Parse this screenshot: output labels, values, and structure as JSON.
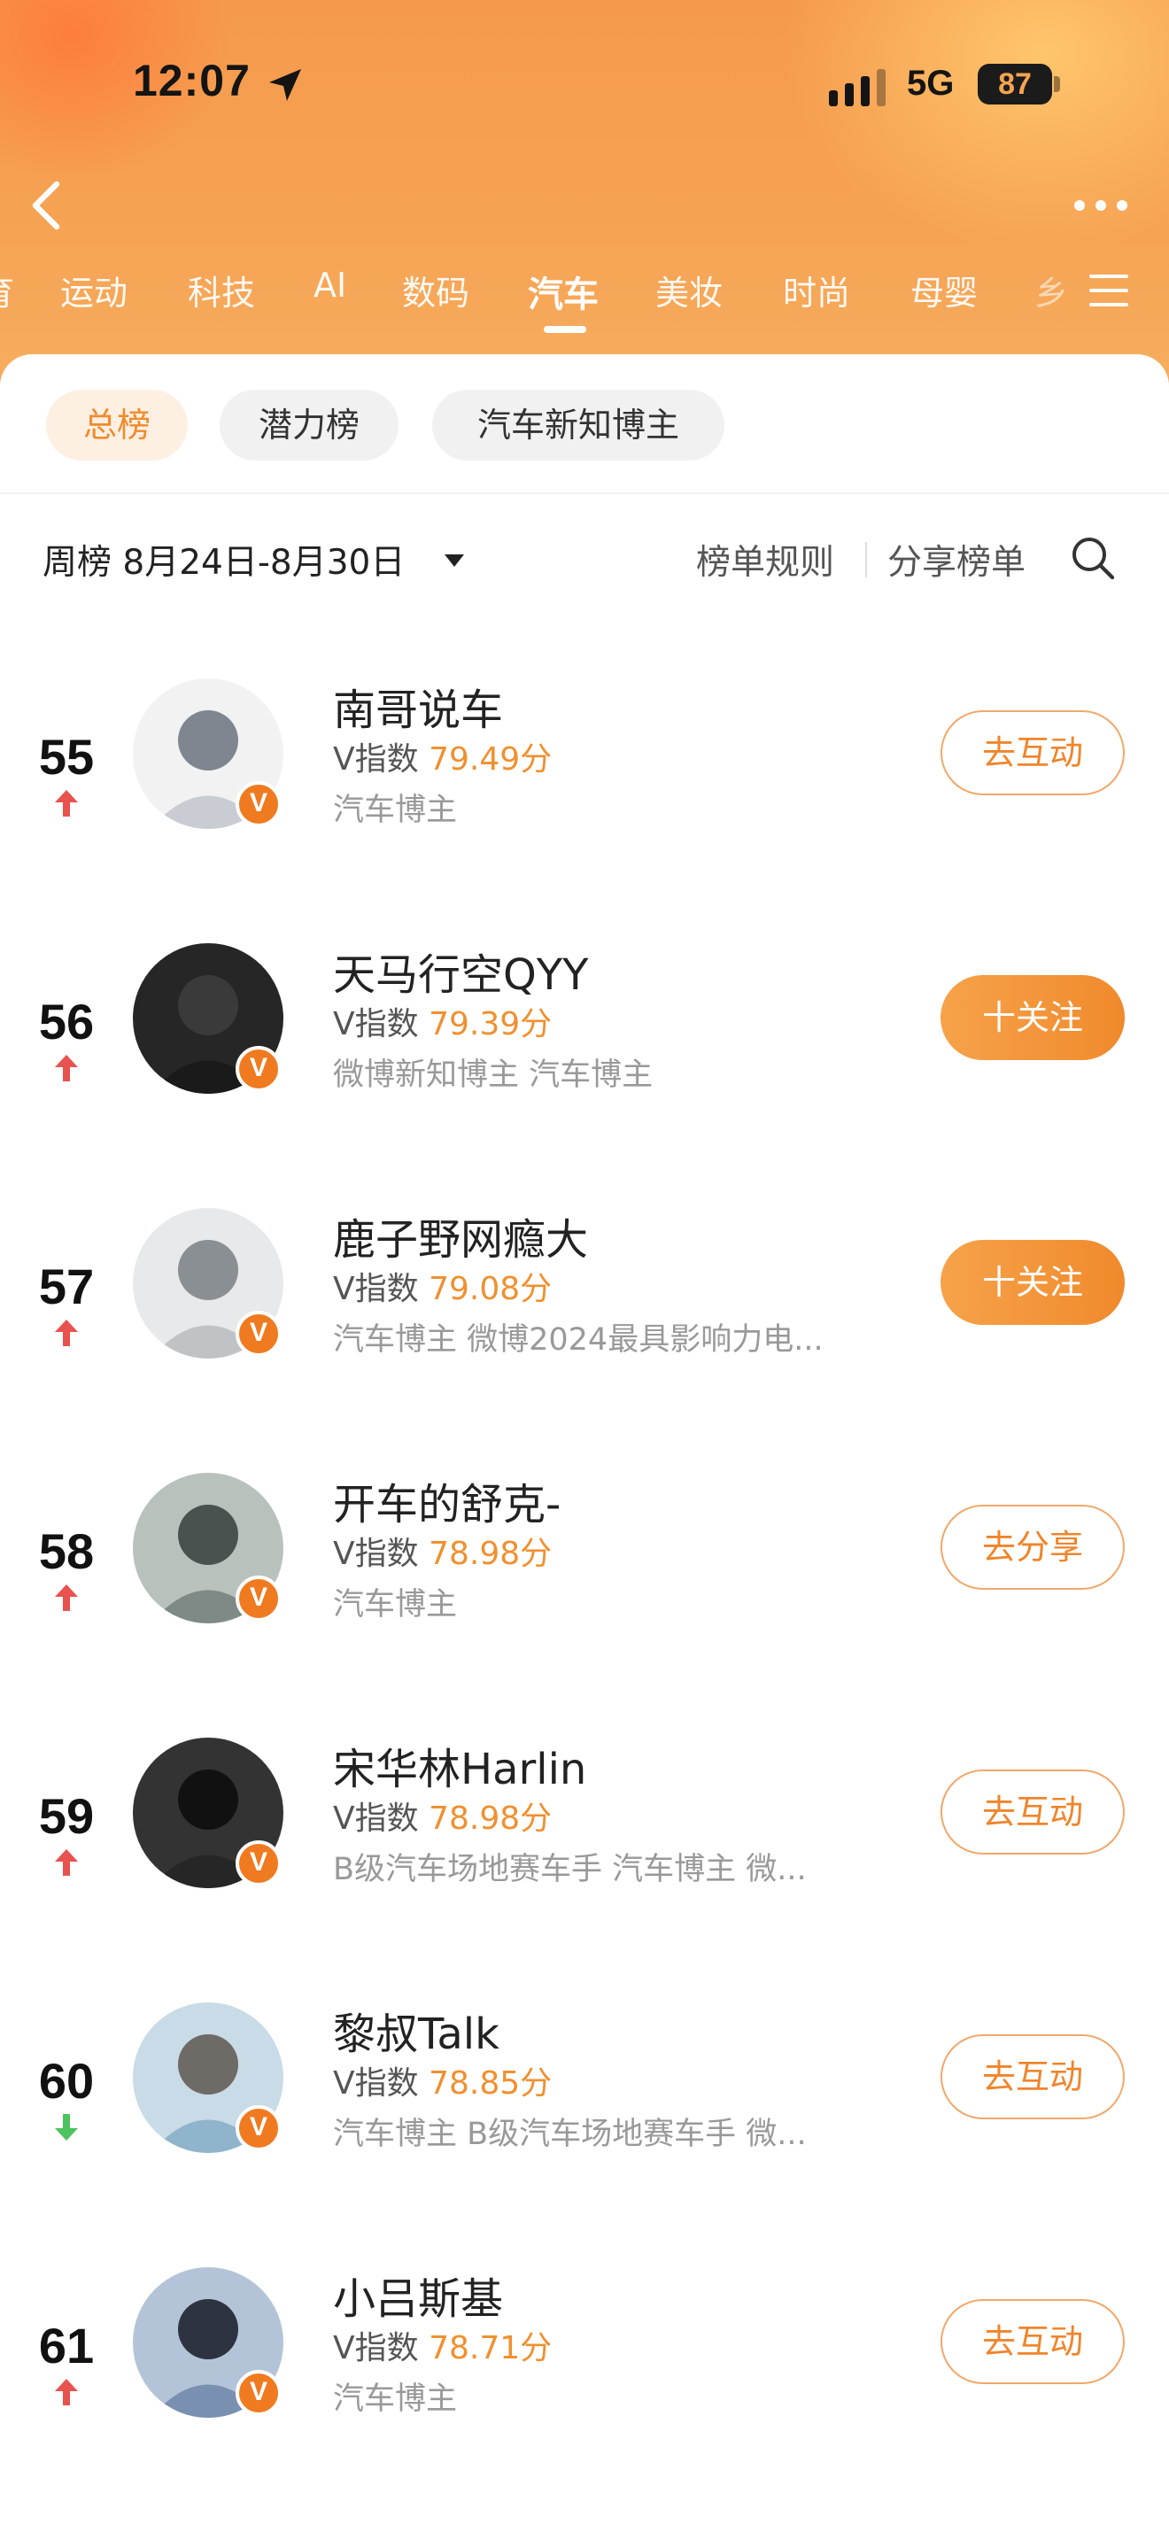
{
  "status_bar": {
    "time": "12:07",
    "network": "5G",
    "battery": "87",
    "icons": [
      "location-arrow-icon",
      "signal-icon"
    ]
  },
  "nav": {
    "back_icon": "chevron-left-icon",
    "more_icon": "more-dots-icon",
    "menu_icon": "hamburger-menu-icon"
  },
  "category_tabs": [
    {
      "label": "育",
      "active": false
    },
    {
      "label": "运动",
      "active": false
    },
    {
      "label": "科技",
      "active": false
    },
    {
      "label": "AI",
      "active": false
    },
    {
      "label": "数码",
      "active": false
    },
    {
      "label": "汽车",
      "active": true
    },
    {
      "label": "美妆",
      "active": false
    },
    {
      "label": "时尚",
      "active": false
    },
    {
      "label": "母婴",
      "active": false
    },
    {
      "label": "乡",
      "active": false
    }
  ],
  "sub_tabs": [
    {
      "label": "总榜",
      "active": true
    },
    {
      "label": "潜力榜",
      "active": false
    },
    {
      "label": "汽车新知博主",
      "active": false
    }
  ],
  "filter": {
    "period": "周榜 8月24日-8月30日",
    "rules": "榜单规则",
    "share": "分享榜单"
  },
  "colors": {
    "accent": "#f0842a",
    "score": "#f0902f",
    "trend_up": "#e8524f",
    "trend_down": "#4cc35f"
  },
  "rankings": [
    {
      "rank": "55",
      "trend": "up",
      "name": "南哥说车",
      "vindex_label": "V指数",
      "score": "79.49分",
      "tags": "汽车博主",
      "action": "去互动",
      "action_filled": false
    },
    {
      "rank": "56",
      "trend": "up",
      "name": "天马行空QYY",
      "vindex_label": "V指数",
      "score": "79.39分",
      "tags": "微博新知博主 汽车博主",
      "action": "十关注",
      "action_filled": true
    },
    {
      "rank": "57",
      "trend": "up",
      "name": "鹿子野网瘾大",
      "vindex_label": "V指数",
      "score": "79.08分",
      "tags": "汽车博主 微博2024最具影响力电...",
      "action": "十关注",
      "action_filled": true
    },
    {
      "rank": "58",
      "trend": "up",
      "name": "开车的舒克-",
      "vindex_label": "V指数",
      "score": "78.98分",
      "tags": "汽车博主",
      "action": "去分享",
      "action_filled": false
    },
    {
      "rank": "59",
      "trend": "up",
      "name": "宋华林Harlin",
      "vindex_label": "V指数",
      "score": "78.98分",
      "tags": "B级汽车场地赛车手 汽车博主 微...",
      "action": "去互动",
      "action_filled": false
    },
    {
      "rank": "60",
      "trend": "down",
      "name": "黎叔Talk",
      "vindex_label": "V指数",
      "score": "78.85分",
      "tags": "汽车博主 B级汽车场地赛车手 微...",
      "action": "去互动",
      "action_filled": false
    },
    {
      "rank": "61",
      "trend": "up",
      "name": "小吕斯基",
      "vindex_label": "V指数",
      "score": "78.71分",
      "tags": "汽车博主",
      "action": "去互动",
      "action_filled": false
    }
  ]
}
